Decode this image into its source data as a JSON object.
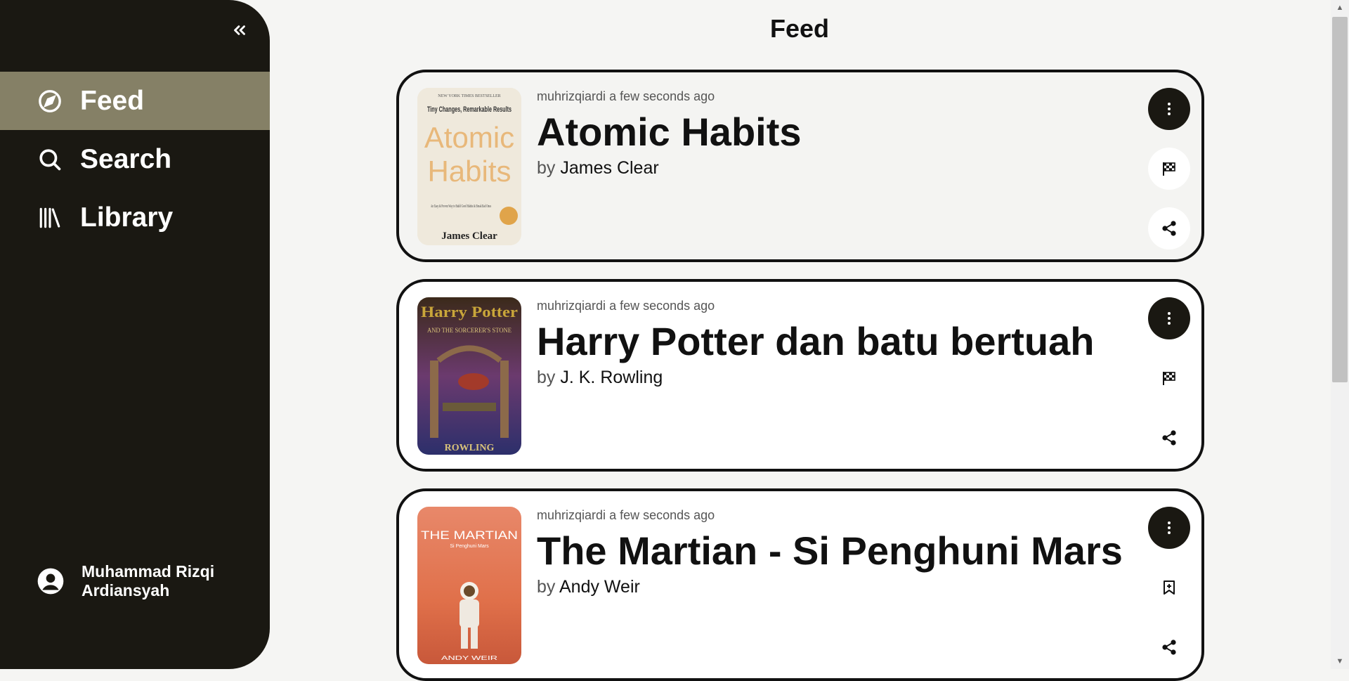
{
  "sidebar": {
    "items": [
      {
        "label": "Feed",
        "icon": "compass-icon",
        "active": true
      },
      {
        "label": "Search",
        "icon": "search-icon",
        "active": false
      },
      {
        "label": "Library",
        "icon": "library-icon",
        "active": false
      }
    ],
    "user": {
      "name": "Muhammad Rizqi Ardiansyah"
    }
  },
  "main": {
    "title": "Feed",
    "cards": [
      {
        "user": "muhrizqiardi",
        "time": "a few seconds ago",
        "title": "Atomic Habits",
        "by": "by",
        "author": "James Clear",
        "cover": {
          "tag": "NEW YORK TIMES BESTSELLER",
          "subtitle": "Tiny Changes, Remarkable Results",
          "big1": "Atomic",
          "big2": "Habits",
          "blurb": "An Easy & Proven Way to Build Good Habits & Break Bad Ones",
          "author": "James Clear"
        },
        "status_icon": "flag-icon"
      },
      {
        "user": "muhrizqiardi",
        "time": "a few seconds ago",
        "title": "Harry Potter dan batu bertuah",
        "by": "by",
        "author": "J. K. Rowling",
        "cover": {
          "big1": "Harry Potter",
          "sub": "AND THE SORCERER'S STONE",
          "author": "ROWLING"
        },
        "status_icon": "flag-icon"
      },
      {
        "user": "muhrizqiardi",
        "time": "a few seconds ago",
        "title": "The Martian - Si Penghuni Mars",
        "by": "by",
        "author": "Andy Weir",
        "cover": {
          "big1": "THE MARTIAN",
          "sub": "Si Penghuni Mars",
          "author": "ANDY WEIR"
        },
        "status_icon": "bookmark-add-icon"
      }
    ]
  }
}
